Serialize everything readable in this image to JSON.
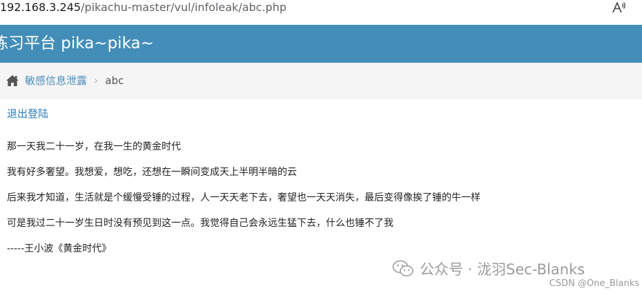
{
  "browser": {
    "url_host": "192.168.3.245",
    "url_path": "/pikachu-master/vul/infoleak/abc.php",
    "read_aloud_icon": "read-aloud-icon"
  },
  "header": {
    "brand_partial_char": "练",
    "brand_title": "习平台 pika~pika~",
    "background_color": "#438eb9"
  },
  "breadcrumb": {
    "home_icon": "home-icon",
    "parent_label": "敏感信息泄露",
    "separator": "›",
    "current_label": "abc"
  },
  "content": {
    "logout_label": "退出登陆",
    "lines": [
      "那一天我二十一岁，在我一生的黄金时代",
      "我有好多奢望。我想爱，想吃，还想在一瞬间变成天上半明半暗的云",
      "后来我才知道，生活就是个缓慢受锤的过程，人一天天老下去，奢望也一天天消失，最后变得像挨了锤的牛一样",
      "可是我过二十一岁生日时没有预见到这一点。我觉得自己会永远生猛下去，什么也锤不了我",
      "-----王小波《黄金时代》"
    ]
  },
  "watermarks": {
    "wechat_text": "公众号 · 泷羽Sec-Blanks",
    "wechat_icon": "wechat-icon",
    "csdn_text": "CSDN @One_Blanks"
  }
}
